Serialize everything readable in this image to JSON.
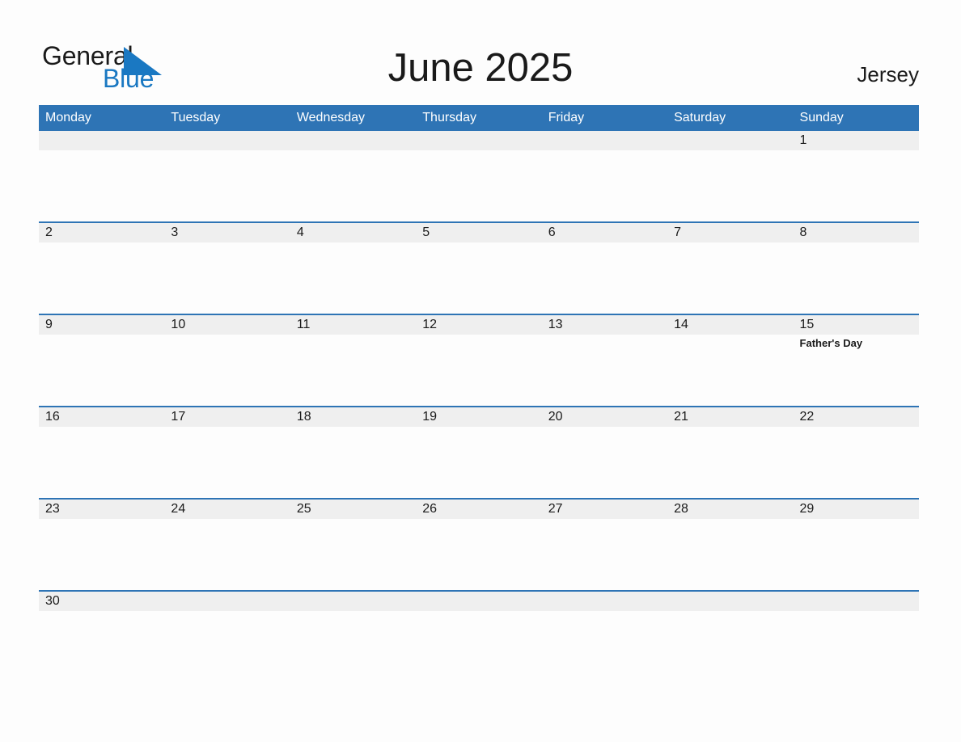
{
  "brand": {
    "name_part1": "General",
    "name_part2": "Blue",
    "triangle_icon": "blue-triangle-icon",
    "black_hex": "#1a1a1a",
    "blue_hex": "#1a78c2"
  },
  "header": {
    "title": "June 2025",
    "region": "Jersey"
  },
  "theme": {
    "header_blue": "#2e74b5",
    "date_band_gray": "#efefef",
    "page_background": "#fdfdfd",
    "row_separator": "#2e74b5",
    "text_color": "#1a1a1a"
  },
  "calendar": {
    "month": "June",
    "year": "2025",
    "weekday_headers": [
      "Monday",
      "Tuesday",
      "Wednesday",
      "Thursday",
      "Friday",
      "Saturday",
      "Sunday"
    ],
    "weeks": [
      {
        "days": [
          {
            "date": "",
            "events": []
          },
          {
            "date": "",
            "events": []
          },
          {
            "date": "",
            "events": []
          },
          {
            "date": "",
            "events": []
          },
          {
            "date": "",
            "events": []
          },
          {
            "date": "",
            "events": []
          },
          {
            "date": "1",
            "events": []
          }
        ]
      },
      {
        "days": [
          {
            "date": "2",
            "events": []
          },
          {
            "date": "3",
            "events": []
          },
          {
            "date": "4",
            "events": []
          },
          {
            "date": "5",
            "events": []
          },
          {
            "date": "6",
            "events": []
          },
          {
            "date": "7",
            "events": []
          },
          {
            "date": "8",
            "events": []
          }
        ]
      },
      {
        "days": [
          {
            "date": "9",
            "events": []
          },
          {
            "date": "10",
            "events": []
          },
          {
            "date": "11",
            "events": []
          },
          {
            "date": "12",
            "events": []
          },
          {
            "date": "13",
            "events": []
          },
          {
            "date": "14",
            "events": []
          },
          {
            "date": "15",
            "events": [
              "Father's Day"
            ]
          }
        ]
      },
      {
        "days": [
          {
            "date": "16",
            "events": []
          },
          {
            "date": "17",
            "events": []
          },
          {
            "date": "18",
            "events": []
          },
          {
            "date": "19",
            "events": []
          },
          {
            "date": "20",
            "events": []
          },
          {
            "date": "21",
            "events": []
          },
          {
            "date": "22",
            "events": []
          }
        ]
      },
      {
        "days": [
          {
            "date": "23",
            "events": []
          },
          {
            "date": "24",
            "events": []
          },
          {
            "date": "25",
            "events": []
          },
          {
            "date": "26",
            "events": []
          },
          {
            "date": "27",
            "events": []
          },
          {
            "date": "28",
            "events": []
          },
          {
            "date": "29",
            "events": []
          }
        ]
      },
      {
        "days": [
          {
            "date": "30",
            "events": []
          },
          {
            "date": "",
            "events": []
          },
          {
            "date": "",
            "events": []
          },
          {
            "date": "",
            "events": []
          },
          {
            "date": "",
            "events": []
          },
          {
            "date": "",
            "events": []
          },
          {
            "date": "",
            "events": []
          }
        ]
      }
    ]
  }
}
